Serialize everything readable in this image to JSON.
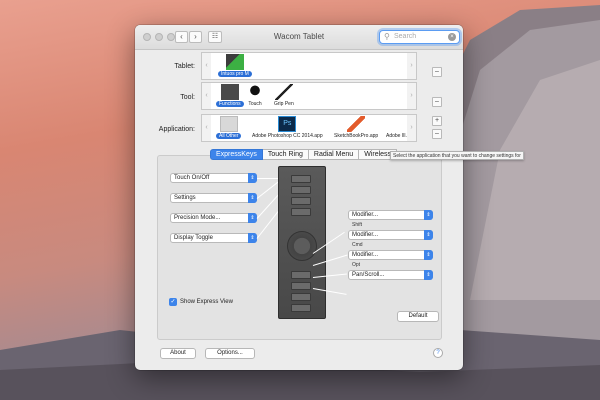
{
  "window": {
    "title": "Wacom Tablet"
  },
  "search": {
    "placeholder": "Search"
  },
  "rows": {
    "tablet": {
      "label": "Tablet:",
      "items": [
        "Intuos pro M"
      ]
    },
    "tool": {
      "label": "Tool:",
      "items": [
        "Functions",
        "Touch",
        "Grip Pen"
      ]
    },
    "application": {
      "label": "Application:",
      "items": [
        "All Other",
        "Adobe Photoshop CC 2014.app",
        "SketchBookPro.app",
        "Adobe Ill..."
      ]
    }
  },
  "tooltip": "Select the application that you want to change settings for",
  "tabs": [
    "ExpressKeys",
    "Touch Ring",
    "Radial Menu",
    "Wireless"
  ],
  "left_keys": [
    "Touch On/Off",
    "Settings",
    "Precision Mode...",
    "Display Toggle"
  ],
  "right_keys": [
    {
      "value": "Modifier...",
      "sub": "Shift"
    },
    {
      "value": "Modifier...",
      "sub": "Cmd"
    },
    {
      "value": "Modifier...",
      "sub": "Opt"
    },
    {
      "value": "Pan/Scroll...",
      "sub": ""
    }
  ],
  "show_express_view": {
    "label": "Show Express View",
    "checked": true
  },
  "buttons": {
    "default": "Default",
    "about": "About",
    "options": "Options..."
  },
  "icons": {
    "search": "magnifier-icon",
    "clear": "clear-icon",
    "help": "help-icon",
    "grid": "grid-icon"
  },
  "colors": {
    "accent": "#3d84ea"
  }
}
